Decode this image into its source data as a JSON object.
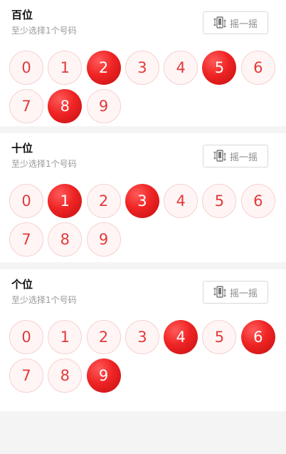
{
  "sections": [
    {
      "title": "百位",
      "hint": "至少选择1个号码",
      "shake_label": "摇一摇",
      "balls": [
        "0",
        "1",
        "2",
        "3",
        "4",
        "5",
        "6",
        "7",
        "8",
        "9"
      ],
      "selected": [
        "2",
        "5",
        "8"
      ]
    },
    {
      "title": "十位",
      "hint": "至少选择1个号码",
      "shake_label": "摇一摇",
      "balls": [
        "0",
        "1",
        "2",
        "3",
        "4",
        "5",
        "6",
        "7",
        "8",
        "9"
      ],
      "selected": [
        "1",
        "3"
      ]
    },
    {
      "title": "个位",
      "hint": "至少选择1个号码",
      "shake_label": "摇一摇",
      "balls": [
        "0",
        "1",
        "2",
        "3",
        "4",
        "5",
        "6",
        "7",
        "8",
        "9"
      ],
      "selected": [
        "4",
        "6",
        "9"
      ]
    }
  ],
  "colors": {
    "accent": "#ef2424",
    "ball_bg": "#fff5f5",
    "ball_border": "#f6d0d0"
  }
}
